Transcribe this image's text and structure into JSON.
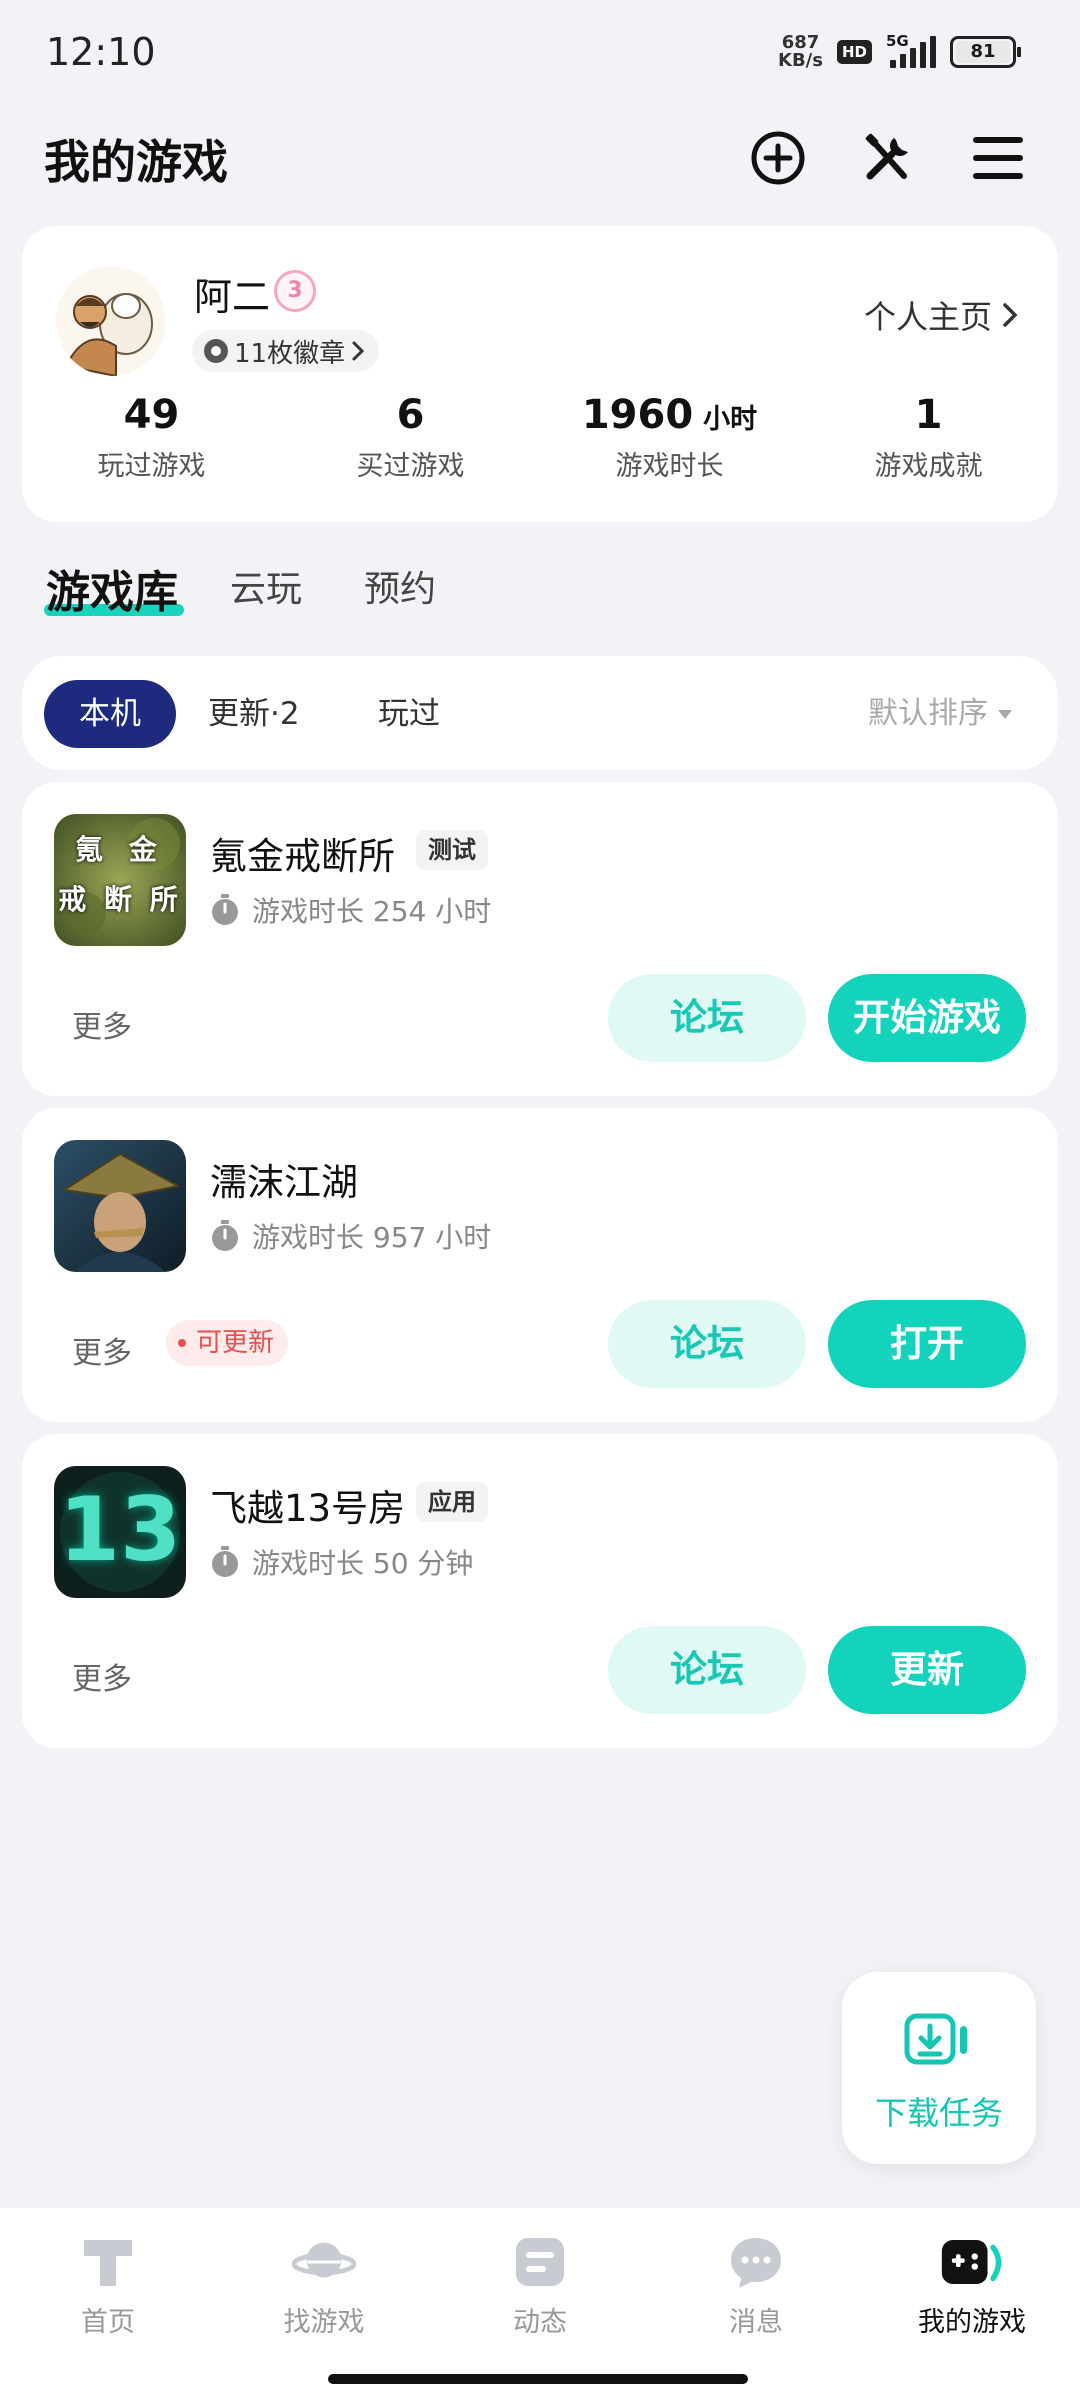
{
  "status_bar": {
    "time": "12:10",
    "net_speed_value": "687",
    "net_speed_unit": "KB/s",
    "hd": "HD",
    "network": "5G",
    "battery": "81"
  },
  "header": {
    "title": "我的游戏",
    "icons": [
      "add-circle-icon",
      "tools-icon",
      "menu-icon"
    ]
  },
  "profile": {
    "name": "阿二",
    "level": "3",
    "badges": "11枚徽章",
    "home_link": "个人主页",
    "stats": [
      {
        "value": "49",
        "unit": "",
        "label": "玩过游戏"
      },
      {
        "value": "6",
        "unit": "",
        "label": "买过游戏"
      },
      {
        "value": "1960",
        "unit": "小时",
        "label": "游戏时长"
      },
      {
        "value": "1",
        "unit": "",
        "label": "游戏成就"
      }
    ]
  },
  "library_tabs": [
    "游戏库",
    "云玩",
    "预约"
  ],
  "filter": {
    "chips": [
      "本机",
      "更新·2",
      "玩过"
    ],
    "sort": "默认排序"
  },
  "games": [
    {
      "name": "氪金戒断所",
      "tag": "测试",
      "playtime": "游戏时长 254 小时",
      "more": "更多",
      "update_badge": "",
      "forum": "论坛",
      "action": "开始游戏",
      "icon_text": [
        "氪",
        "金",
        "戒",
        "断",
        "所"
      ]
    },
    {
      "name": "濡沫江湖",
      "tag": "",
      "playtime": "游戏时长 957 小时",
      "more": "更多",
      "update_badge": "可更新",
      "forum": "论坛",
      "action": "打开"
    },
    {
      "name": "飞越13号房",
      "tag": "应用",
      "playtime": "游戏时长 50 分钟",
      "more": "更多",
      "update_badge": "",
      "forum": "论坛",
      "action": "更新",
      "icon_text": "13"
    }
  ],
  "download_fab": {
    "label": "下载任务"
  },
  "bottom_nav": [
    {
      "label": "首页",
      "icon": "taptap-home-icon"
    },
    {
      "label": "找游戏",
      "icon": "planet-icon"
    },
    {
      "label": "动态",
      "icon": "feed-icon"
    },
    {
      "label": "消息",
      "icon": "chat-bubble-icon"
    },
    {
      "label": "我的游戏",
      "icon": "gamepad-icon",
      "active": true
    }
  ],
  "colors": {
    "accent": "#14d3bd",
    "accent_light": "#e0f9f5",
    "chip_active": "#1d2a7e",
    "update_red": "#e94f4f",
    "background": "#f2f3f7"
  }
}
